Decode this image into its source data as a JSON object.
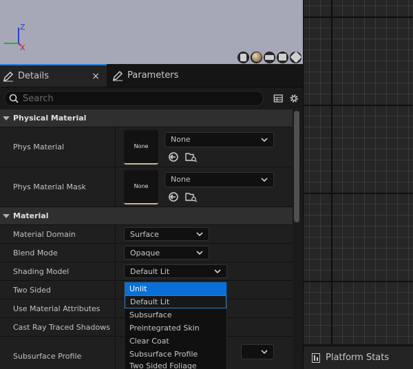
{
  "viewport": {
    "axis_z": "Z",
    "axis_x": "X"
  },
  "tabs": {
    "details": "Details",
    "close": "×",
    "parameters": "Parameters"
  },
  "search": {
    "placeholder": "Search"
  },
  "categories": {
    "physical_material": "Physical Material",
    "material": "Material"
  },
  "physical": {
    "phys_material_label": "Phys Material",
    "phys_material_thumb": "None",
    "phys_material_value": "None",
    "phys_material_mask_label": "Phys Material Mask",
    "phys_material_mask_thumb": "None",
    "phys_material_mask_value": "None"
  },
  "material": {
    "domain_label": "Material Domain",
    "domain_value": "Surface",
    "blend_label": "Blend Mode",
    "blend_value": "Opaque",
    "shading_label": "Shading Model",
    "shading_value": "Default Lit",
    "two_sided_label": "Two Sided",
    "use_attr_label": "Use Material Attributes",
    "cast_shadows_label": "Cast Ray Traced Shadows",
    "subsurface_label": "Subsurface Profile"
  },
  "shading_options": [
    "Unlit",
    "Default Lit",
    "Subsurface",
    "Preintegrated Skin",
    "Clear Coat",
    "Subsurface Profile",
    "Two Sided Foliage"
  ],
  "stats_tab": {
    "label": "Platform Stats"
  },
  "colors": {
    "accent": "#2a7fd6",
    "hover": "#0a70d8",
    "viewport_bg": "#a6a8b8"
  }
}
